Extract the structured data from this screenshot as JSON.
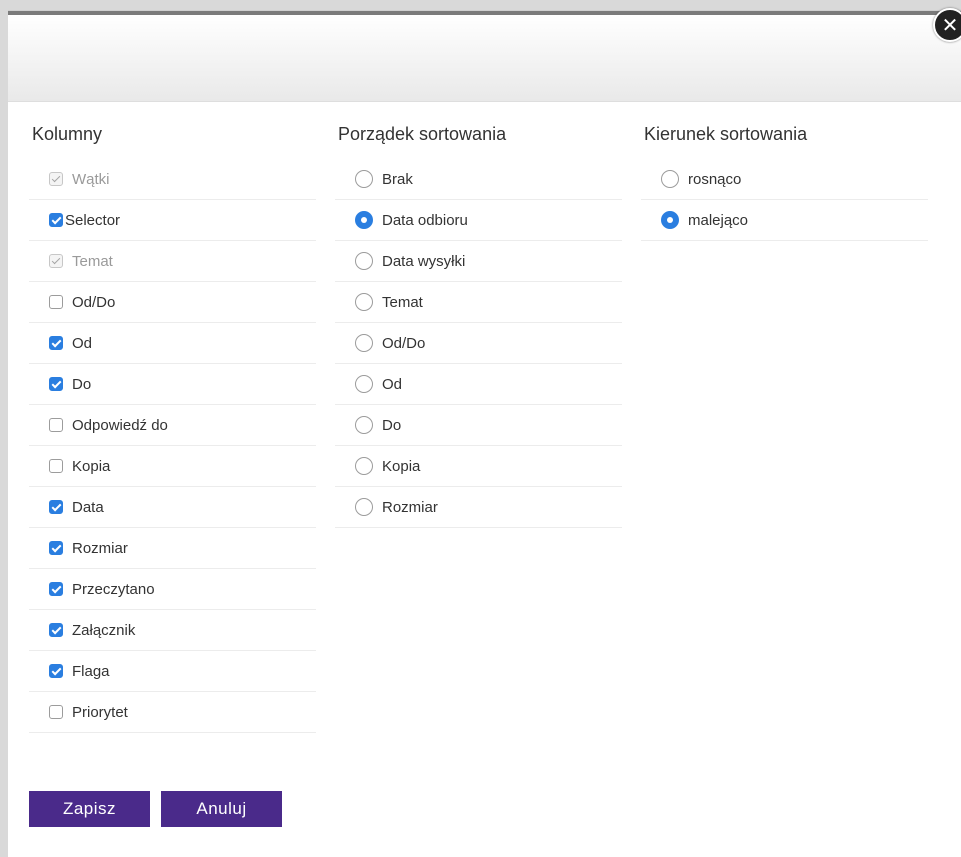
{
  "close_icon": "✕",
  "columns_section": {
    "title": "Kolumny",
    "items": [
      {
        "label": "Wątki",
        "state": "disabled"
      },
      {
        "label": "Selector",
        "state": "checked-tight"
      },
      {
        "label": "Temat",
        "state": "disabled"
      },
      {
        "label": "Od/Do",
        "state": "unchecked"
      },
      {
        "label": "Od",
        "state": "checked"
      },
      {
        "label": "Do",
        "state": "checked"
      },
      {
        "label": "Odpowiedź do",
        "state": "unchecked"
      },
      {
        "label": "Kopia",
        "state": "unchecked"
      },
      {
        "label": "Data",
        "state": "checked"
      },
      {
        "label": "Rozmiar",
        "state": "checked"
      },
      {
        "label": "Przeczytano",
        "state": "checked"
      },
      {
        "label": "Załącznik",
        "state": "checked"
      },
      {
        "label": "Flaga",
        "state": "checked"
      },
      {
        "label": "Priorytet",
        "state": "unchecked"
      }
    ]
  },
  "sort_order_section": {
    "title": "Porządek sortowania",
    "items": [
      {
        "label": "Brak",
        "selected": false
      },
      {
        "label": "Data odbioru",
        "selected": true
      },
      {
        "label": "Data wysyłki",
        "selected": false
      },
      {
        "label": "Temat",
        "selected": false
      },
      {
        "label": "Od/Do",
        "selected": false
      },
      {
        "label": "Od",
        "selected": false
      },
      {
        "label": "Do",
        "selected": false
      },
      {
        "label": "Kopia",
        "selected": false
      },
      {
        "label": "Rozmiar",
        "selected": false
      }
    ]
  },
  "sort_direction_section": {
    "title": "Kierunek sortowania",
    "items": [
      {
        "label": "rosnąco",
        "selected": false
      },
      {
        "label": "malejąco",
        "selected": true
      }
    ]
  },
  "footer": {
    "save_label": "Zapisz",
    "cancel_label": "Anuluj"
  },
  "colors": {
    "accent": "#2a7ee0",
    "button_bg": "#4a2a8a"
  }
}
